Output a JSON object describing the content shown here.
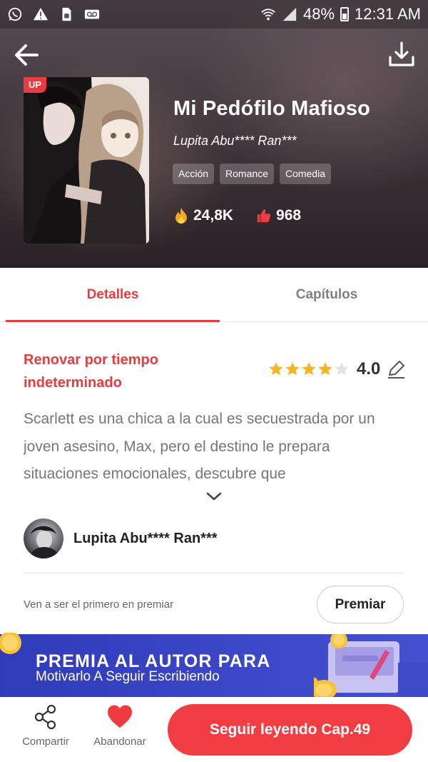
{
  "status_bar": {
    "battery": "48%",
    "time": "12:31 AM",
    "icons": [
      "whatsapp-icon",
      "warning-icon",
      "sim-icon",
      "voicemail-icon",
      "wifi-icon",
      "signal-icon",
      "battery-icon"
    ]
  },
  "book": {
    "badge": "UP",
    "title": "Mi Pedófilo Mafioso",
    "author": "Lupita Abu**** Ran***",
    "tags": [
      "Acción",
      "Romance",
      "Comedia"
    ],
    "views": "24,8K",
    "likes": "968"
  },
  "tabs": [
    {
      "label": "Detalles",
      "active": true
    },
    {
      "label": "Capítulos",
      "active": false
    }
  ],
  "details": {
    "status": "Renovar por tiempo indeterminado",
    "rating": "4.0",
    "rating_stars": 4,
    "synopsis": "Scarlett es una chica a la cual es secuestrada por un joven asesino, Max, pero el destino le prepara situaciones emocionales, descubre que"
  },
  "author_card": {
    "name": "Lupita Abu**** Ran***"
  },
  "reward": {
    "prompt": "Ven a ser el primero en premiar",
    "button": "Premiar"
  },
  "banner": {
    "title": "PREMIA AL AUTOR PARA",
    "subtitle": "Motivarlo A Seguir Escribiendo"
  },
  "bottom_bar": {
    "share": "Compartir",
    "quit": "Abandonar",
    "cta": "Seguir leyendo Cap.49"
  },
  "colors": {
    "accent": "#ea3c3f",
    "cta": "#f23e43",
    "banner": "#3a46c6",
    "star": "#f5b52b"
  }
}
